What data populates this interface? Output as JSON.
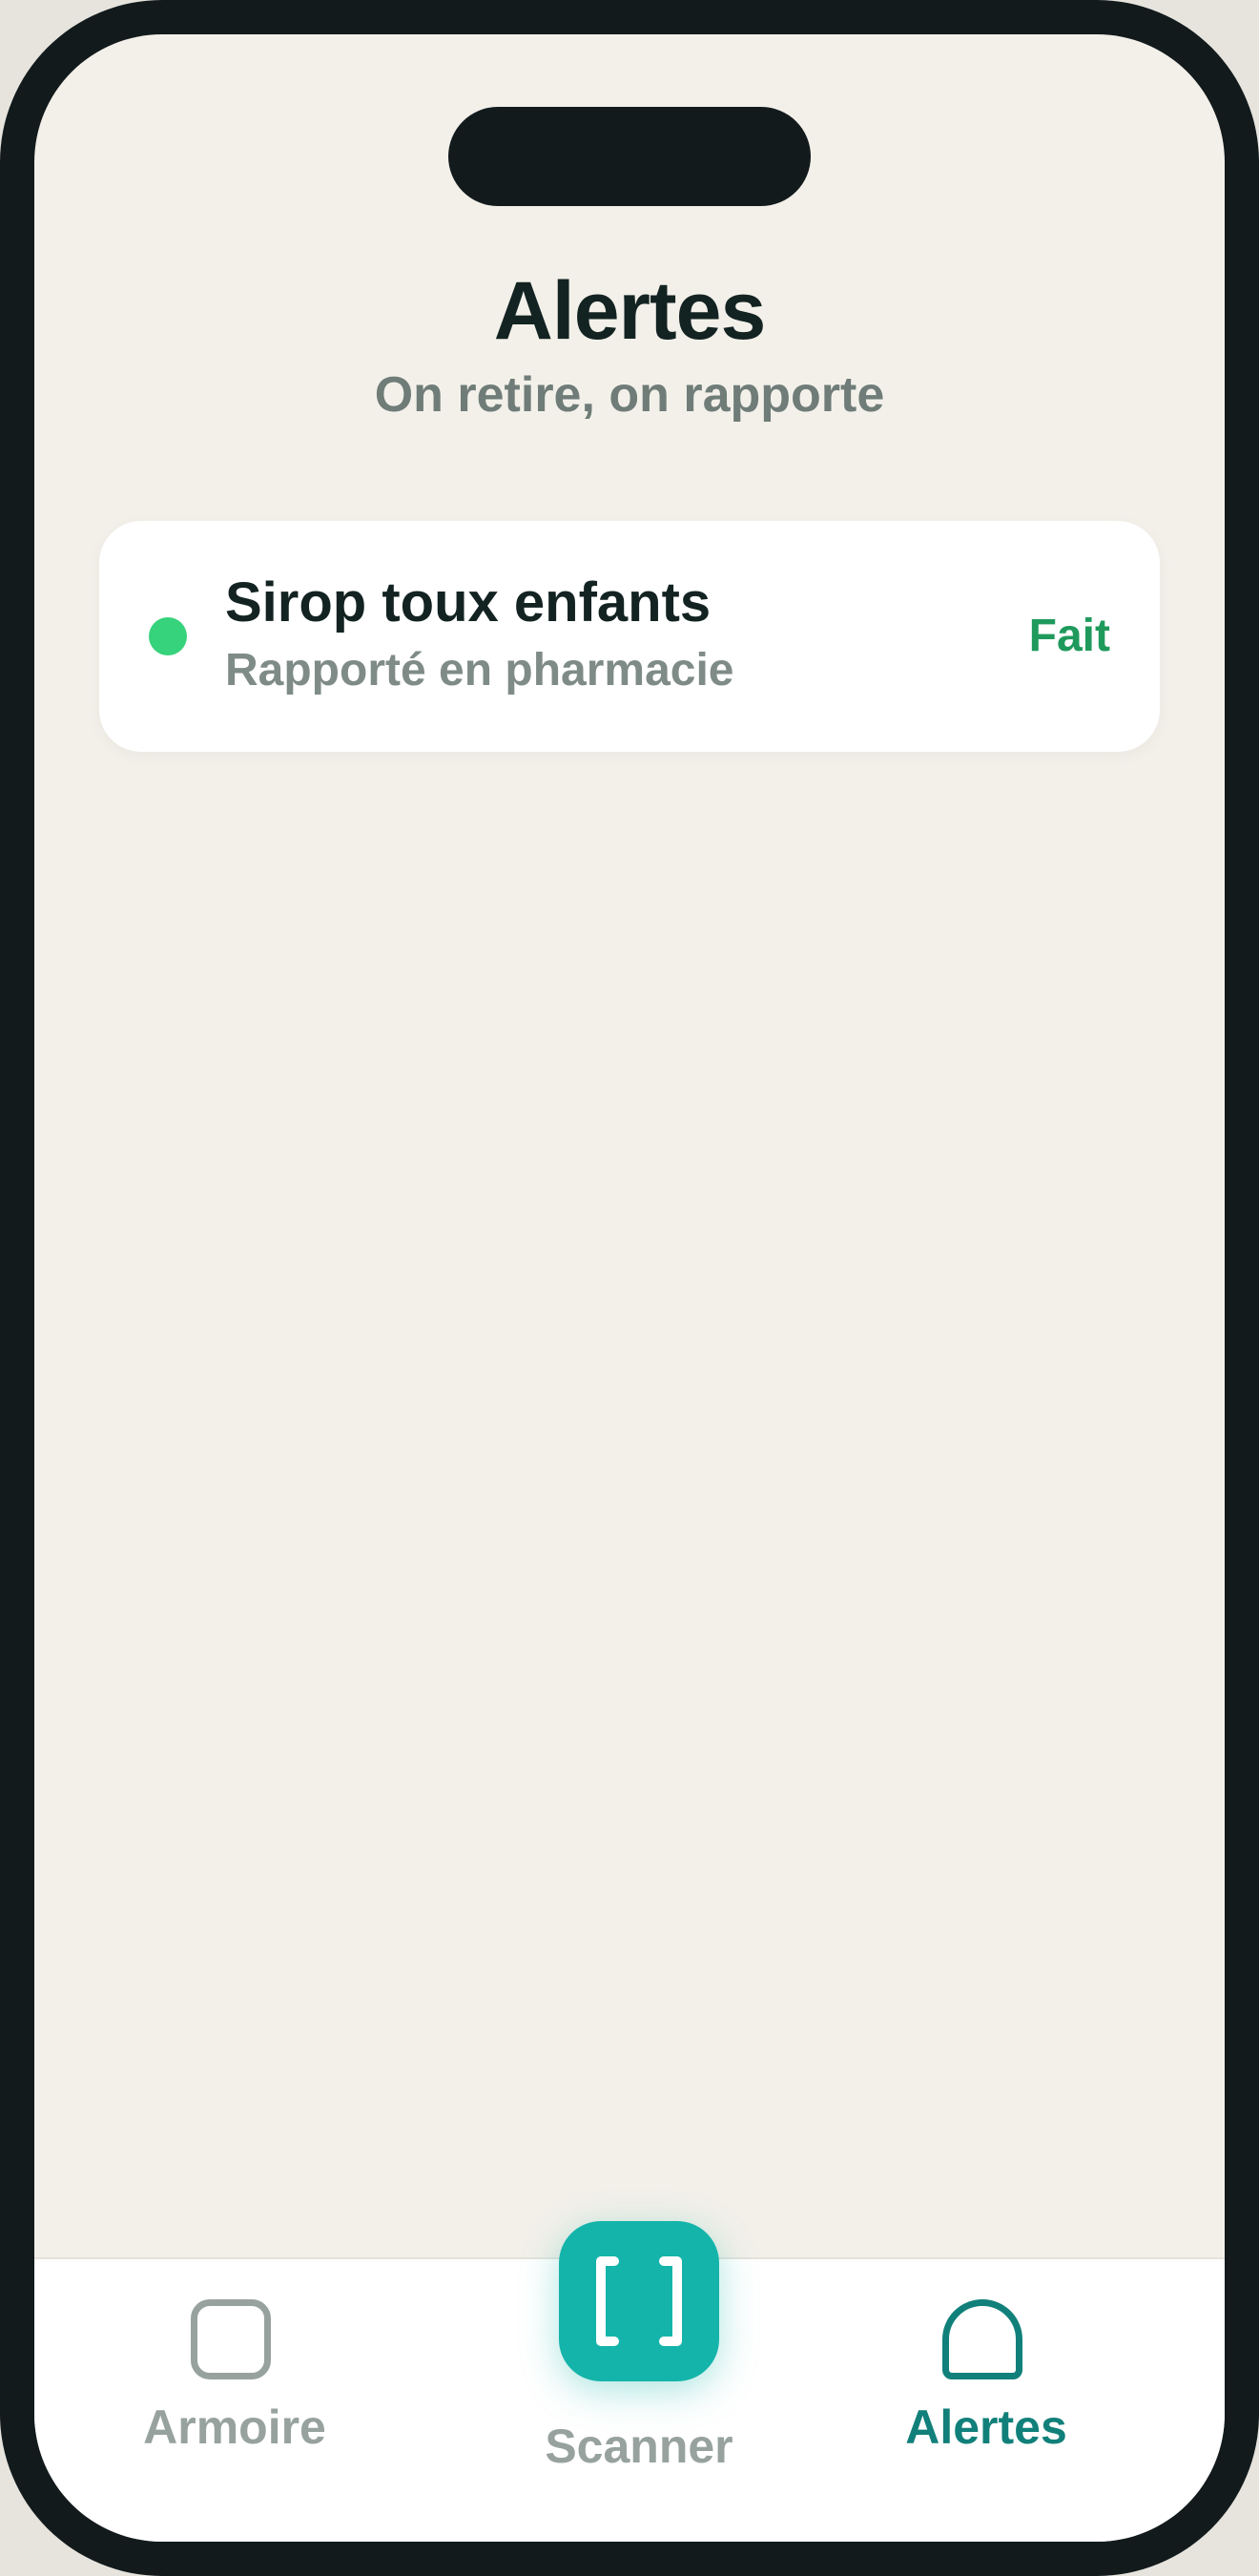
{
  "header": {
    "title": "Alertes",
    "subtitle": "On retire, on rapporte"
  },
  "alerts": [
    {
      "name": "Sirop toux enfants",
      "detail": "Rapporté en pharmacie",
      "status": "Fait",
      "dot_color": "#36d27c",
      "status_color": "#1f9a5c"
    }
  ],
  "tabbar": {
    "armoire": {
      "label": "Armoire",
      "icon": "cabinet-icon"
    },
    "scanner": {
      "label": "Scanner",
      "icon": "scan-frame-icon"
    },
    "alertes": {
      "label": "Alertes",
      "icon": "bell-icon",
      "active": true
    }
  },
  "colors": {
    "accent": "#14b4aa",
    "active_tab": "#11807a",
    "inactive_tab": "#97a29e",
    "background": "#f3f0ea"
  }
}
